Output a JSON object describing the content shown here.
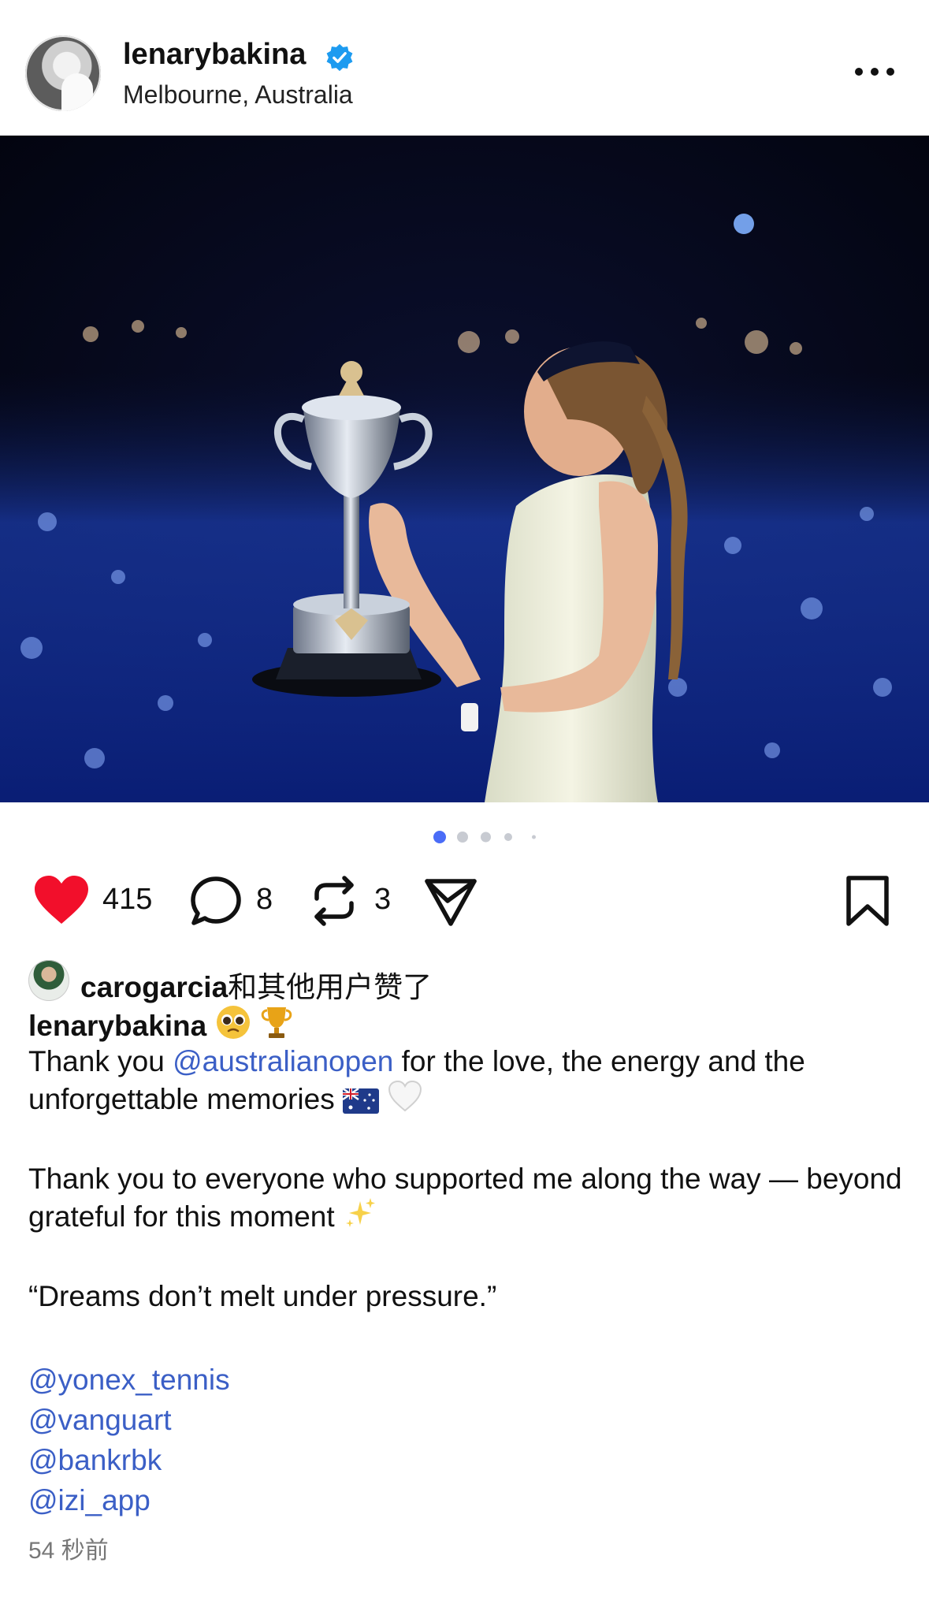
{
  "post": {
    "username": "lenarybakina",
    "location": "Melbourne, Australia",
    "time": "54 秒前"
  },
  "carousel": {
    "count": 5,
    "active_index": 0
  },
  "actions": {
    "likes": "415",
    "comments": "8",
    "reposts": "3"
  },
  "liked_by": {
    "user": "carogarcia",
    "suffix": "和其他用户赞了"
  },
  "caption": {
    "user": "lenarybakina",
    "line1_a": "Thank you ",
    "line1_mention": "@australianopen",
    "line1_b": " for the love, the energy and the unforgettable memories",
    "line2": "Thank you to everyone who supported me along the way — beyond grateful for this moment",
    "quote": "“Dreams don’t melt under pressure.”",
    "tags": [
      "@yonex_tennis",
      "@vanguart",
      "@bankrbk",
      "@izi_app"
    ]
  },
  "colors": {
    "heart": "#f20f2b",
    "mention": "#3b5fc6",
    "dot_active": "#4a6cf7",
    "dot_inactive": "#c8cbd2",
    "verified": "#1d9bf0"
  },
  "icons": [
    "verified-badge-icon",
    "more-icon",
    "heart-icon",
    "comment-icon",
    "repost-icon",
    "share-icon",
    "bookmark-icon",
    "pleading-face-emoji",
    "trophy-emoji",
    "australia-flag-emoji",
    "white-heart-emoji",
    "sparkles-emoji"
  ]
}
